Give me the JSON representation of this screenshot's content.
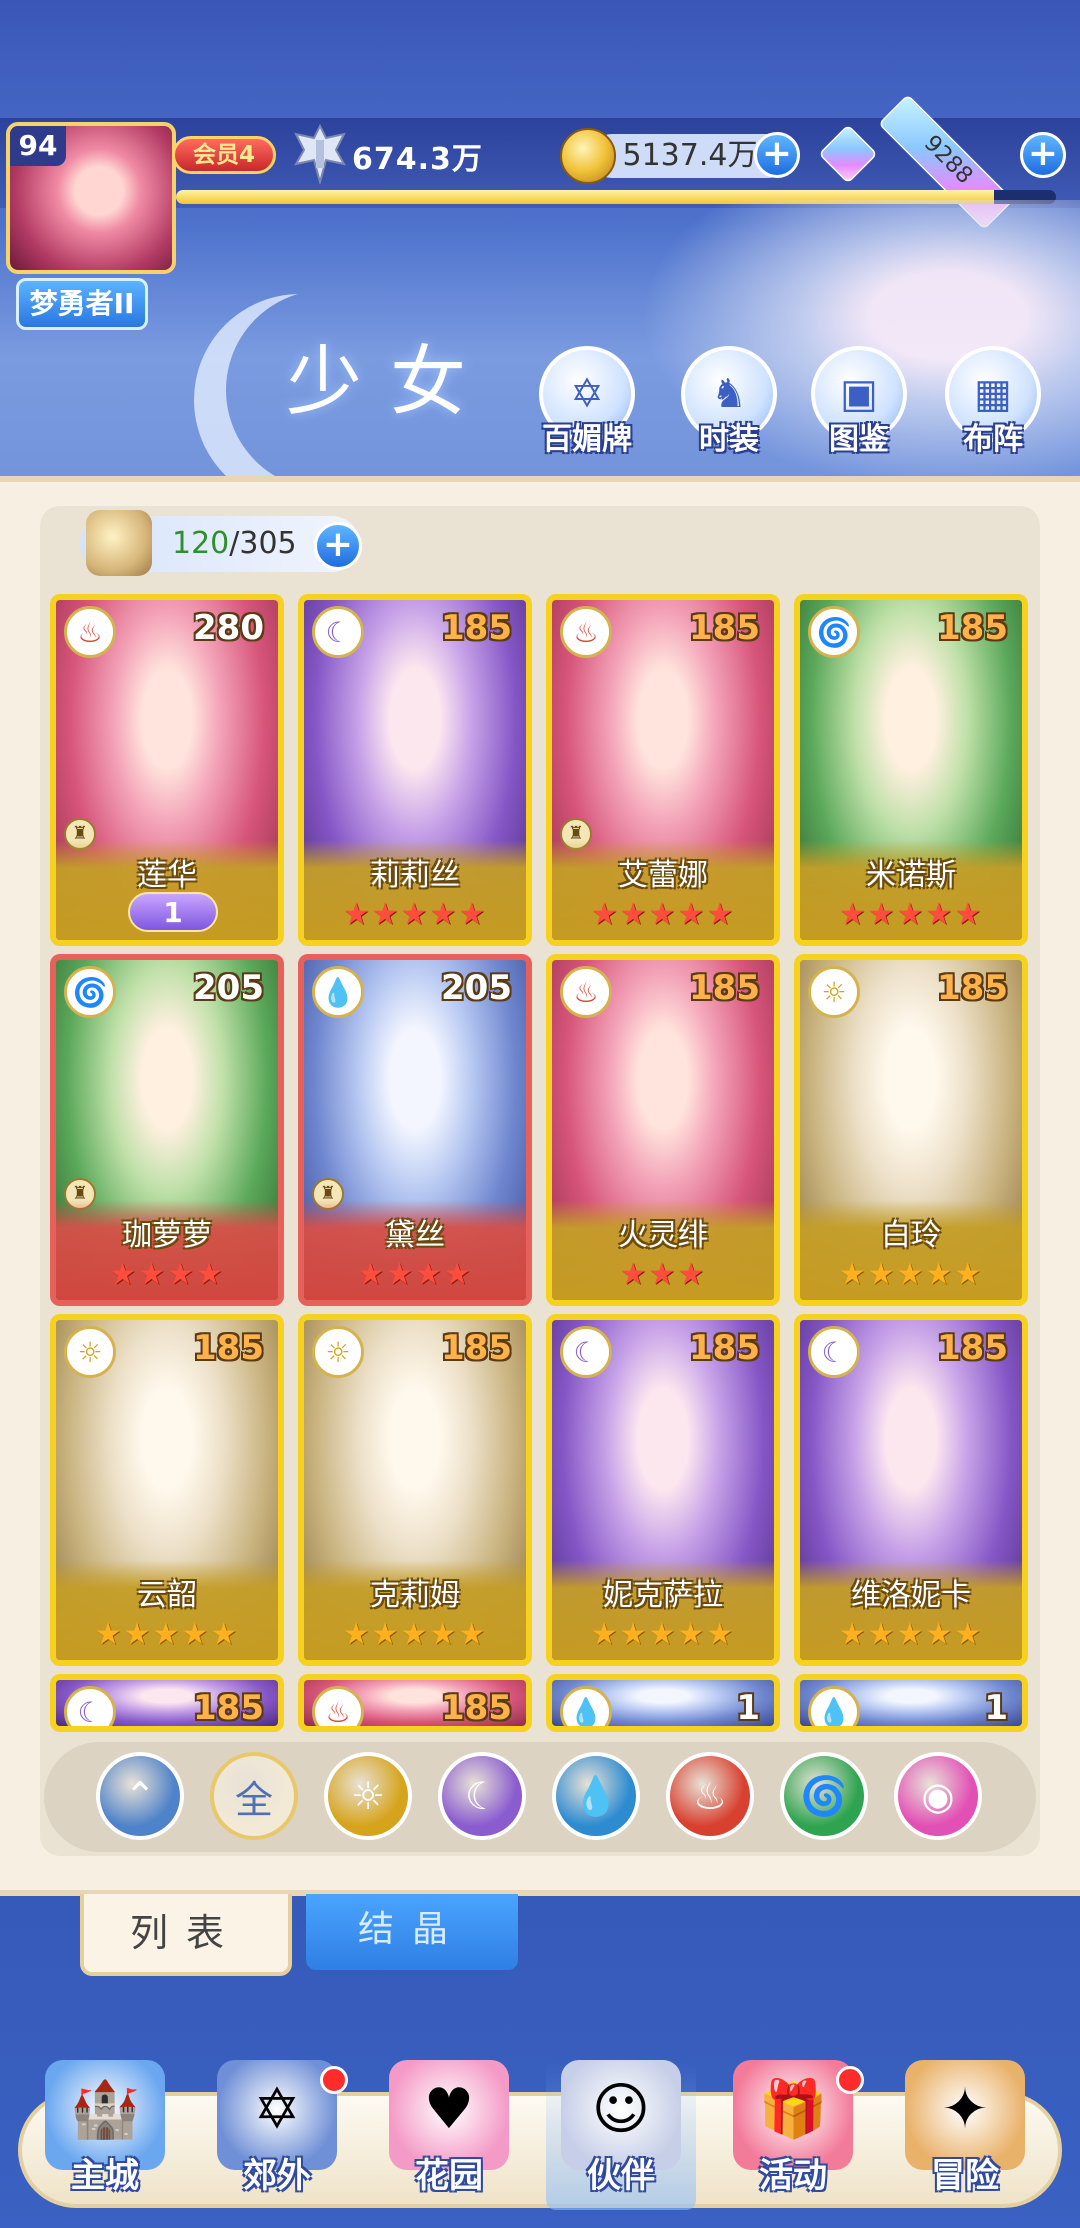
{
  "header": {
    "player_level": "94",
    "player_rank": "梦勇者II",
    "vip_label": "会员4",
    "power": "674.3万",
    "gold": "5137.4万",
    "gems": "9288",
    "plus_symbol": "+",
    "exp_progress": 0.93
  },
  "banner": {
    "title": "少女",
    "menu": [
      {
        "label": "百媚牌",
        "icon": "card-deck-icon"
      },
      {
        "label": "时装",
        "icon": "fashion-icon"
      },
      {
        "label": "图鉴",
        "icon": "codex-icon"
      },
      {
        "label": "布阵",
        "icon": "formation-icon"
      }
    ]
  },
  "roster": {
    "count_current": "120",
    "count_separator": "/",
    "count_max": "305",
    "cards": [
      {
        "name": "莲华",
        "level": "280",
        "element": "fire",
        "stars": 0,
        "badge": "1",
        "frame": "gold",
        "level_color": "white"
      },
      {
        "name": "莉莉丝",
        "level": "185",
        "element": "moon",
        "stars": 5,
        "frame": "gold",
        "level_color": "gold"
      },
      {
        "name": "艾蕾娜",
        "level": "185",
        "element": "fire",
        "stars": 5,
        "frame": "gold",
        "level_color": "gold"
      },
      {
        "name": "米诺斯",
        "level": "185",
        "element": "wind",
        "stars": 5,
        "frame": "gold",
        "level_color": "gold"
      },
      {
        "name": "珈萝萝",
        "level": "205",
        "element": "wind",
        "stars": 4,
        "frame": "red",
        "level_color": "white"
      },
      {
        "name": "黛丝",
        "level": "205",
        "element": "water",
        "stars": 4,
        "frame": "red",
        "level_color": "white"
      },
      {
        "name": "火灵绯",
        "level": "185",
        "element": "fire",
        "stars": 3,
        "frame": "gold",
        "level_color": "gold"
      },
      {
        "name": "白玲",
        "level": "185",
        "element": "sun",
        "stars": 5,
        "frame": "gold",
        "level_color": "gold"
      },
      {
        "name": "云韶",
        "level": "185",
        "element": "sun",
        "stars": 5,
        "frame": "gold",
        "level_color": "gold"
      },
      {
        "name": "克莉姆",
        "level": "185",
        "element": "sun",
        "stars": 5,
        "frame": "gold",
        "level_color": "gold"
      },
      {
        "name": "妮克萨拉",
        "level": "185",
        "element": "moon",
        "stars": 5,
        "frame": "gold",
        "level_color": "gold"
      },
      {
        "name": "维洛妮卡",
        "level": "185",
        "element": "moon",
        "stars": 5,
        "frame": "gold",
        "level_color": "gold"
      }
    ],
    "partial_cards": [
      {
        "level": "185",
        "element": "moon"
      },
      {
        "level": "185",
        "element": "fire"
      },
      {
        "level": "1",
        "element": "water"
      },
      {
        "level": "1",
        "element": "water"
      }
    ]
  },
  "filters": [
    {
      "icon": "collapse-icon",
      "label": "",
      "color": "#4f83c9"
    },
    {
      "icon": "all-icon",
      "label": "全",
      "color": "#f2e9d6"
    },
    {
      "icon": "sun-icon",
      "label": "",
      "color": "#d6a41c"
    },
    {
      "icon": "moon-icon",
      "label": "",
      "color": "#8a5cd0"
    },
    {
      "icon": "water-icon",
      "label": "",
      "color": "#2c8bd1"
    },
    {
      "icon": "fire-icon",
      "label": "",
      "color": "#d8402f"
    },
    {
      "icon": "wind-icon",
      "label": "",
      "color": "#2fa450"
    },
    {
      "icon": "charm-icon",
      "label": "",
      "color": "#e24fb5"
    }
  ],
  "tabs": {
    "list": "列表",
    "crystal": "结晶"
  },
  "nav": [
    {
      "label": "主城",
      "icon": "castle-icon",
      "dot": false
    },
    {
      "label": "郊外",
      "icon": "portal-icon",
      "dot": true
    },
    {
      "label": "花园",
      "icon": "heart-garden-icon",
      "dot": false
    },
    {
      "label": "伙伴",
      "icon": "partner-icon",
      "dot": false,
      "active": true
    },
    {
      "label": "活动",
      "icon": "gift-icon",
      "dot": true
    },
    {
      "label": "冒险",
      "icon": "compass-icon",
      "dot": false
    }
  ],
  "colors": {
    "fire": "#d8402f",
    "moon": "#8a5cd0",
    "wind": "#2fa450",
    "water": "#2c8bd1",
    "sun": "#d6a41c"
  }
}
